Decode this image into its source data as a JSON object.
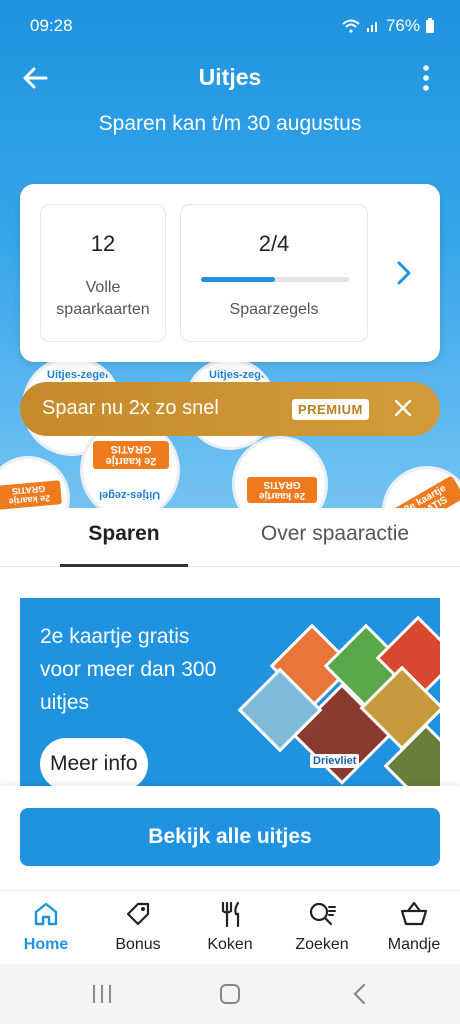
{
  "status": {
    "time": "09:28",
    "battery": "76%"
  },
  "appbar": {
    "title": "Uitjes",
    "subtitle": "Sparen kan t/m 30 augustus"
  },
  "deco": {
    "ticket_text": "2e kaartje GRATIS",
    "label": "Uitjes-zegel"
  },
  "stats": {
    "full_cards": {
      "value": "12",
      "label": "Volle spaarkaarten"
    },
    "stamps": {
      "value": "2/4",
      "label": "Spaarzegels",
      "progress": 0.5
    }
  },
  "premium": {
    "text": "Spaar nu 2x zo snel",
    "badge": "PREMIUM"
  },
  "tabs": [
    {
      "label": "Sparen",
      "active": true
    },
    {
      "label": "Over spaaractie",
      "active": false
    }
  ],
  "promo": {
    "headline": "2e kaartje gratis voor meer dan 300 uitjes",
    "button": "Meer info",
    "brand": "Drievliet"
  },
  "cta": {
    "label": "Bekijk alle uitjes"
  },
  "nav": [
    {
      "label": "Home",
      "icon": "home-icon",
      "active": true
    },
    {
      "label": "Bonus",
      "icon": "tag-icon",
      "active": false
    },
    {
      "label": "Koken",
      "icon": "cutlery-icon",
      "active": false
    },
    {
      "label": "Zoeken",
      "icon": "search-icon",
      "active": false
    },
    {
      "label": "Mandje",
      "icon": "basket-icon",
      "active": false
    }
  ],
  "colors": {
    "brand": "#1f93e0",
    "premium": "#c68a2a",
    "ticket": "#f07a1e"
  }
}
